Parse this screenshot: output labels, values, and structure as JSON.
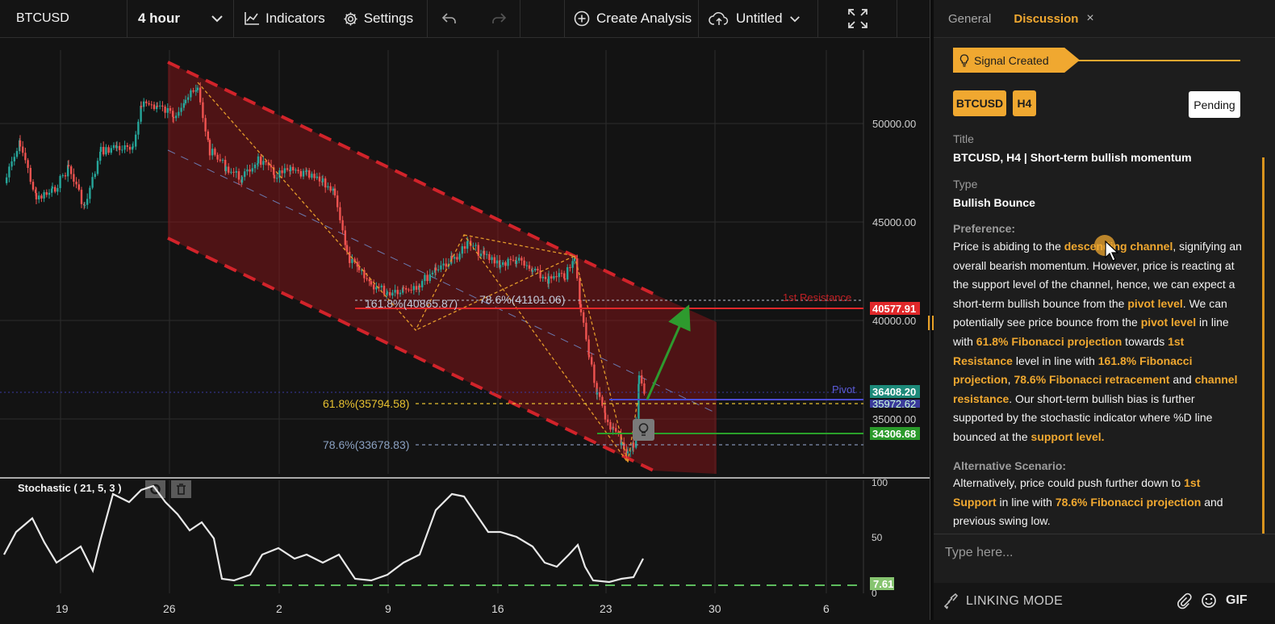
{
  "toolbar": {
    "symbol": "BTCUSD",
    "timeframe": "4 hour",
    "indicators_label": "Indicators",
    "settings_label": "Settings",
    "create_label": "Create Analysis",
    "untitled_label": "Untitled",
    "icons": {
      "timeframe": "chevron-down-icon",
      "indicators": "line-chart-icon",
      "settings": "gear-icon",
      "undo": "undo-icon",
      "redo": "redo-icon",
      "create": "plus-circle-icon",
      "untitled": "cloud-upload-icon",
      "untitled_dropdown": "chevron-down-icon",
      "fullscreen": "fullscreen-icon"
    }
  },
  "chart": {
    "price_axis": [
      "50000.00",
      "45000.00",
      "40000.00",
      "35000.00"
    ],
    "date_axis": [
      "19",
      "26",
      "2",
      "9",
      "16",
      "23",
      "30",
      "6"
    ],
    "price_tags": [
      {
        "text": "40577.91",
        "color": "#e0282a"
      },
      {
        "text": "36408.20",
        "color": "#1d8a7a"
      },
      {
        "text": "35972.62",
        "color": "#3a3a9a"
      },
      {
        "text": "34306.68",
        "color": "#2a9a2a"
      }
    ],
    "fib_labels": {
      "proj_161": "161.8%(40865.87)",
      "retr_786": "78.6%(41101.06)",
      "ret_618": "61.8%(35794.58)",
      "ret_786": "78.6%(33678.83)"
    },
    "level_labels": {
      "resistance": "1st Resistance",
      "pivot": "Pivot"
    },
    "stochastic": {
      "title": "Stochastic ( 21, 5, 3 )",
      "axis": [
        "100",
        "50",
        "0"
      ],
      "value_tag": "7.61"
    },
    "colors": {
      "channel": "#d2232a",
      "resistance": "#e0282a",
      "pivot": "#4b4bd0",
      "support": "#2aa02a",
      "fib": "#f0a830",
      "arrow": "#2e9a2e"
    }
  },
  "panel": {
    "tabs": {
      "general": "General",
      "discussion": "Discussion",
      "close": "×"
    },
    "signal": "Signal Created",
    "tags": {
      "symbol": "BTCUSD",
      "timeframe": "H4"
    },
    "status": "Pending",
    "title_label": "Title",
    "title_value": "BTCUSD, H4 | Short-term bullish momentum",
    "type_label": "Type",
    "type_value": "Bullish Bounce",
    "preference_label": "Preference:",
    "preference_segments": [
      {
        "t": "Price is abiding to the ",
        "h": false
      },
      {
        "t": "descending channel",
        "h": true
      },
      {
        "t": ", signifying an overall bearish momentum. However,  price is reacting at the support level of the channel, hence, we can expect a short-term bullish bounce from the ",
        "h": false
      },
      {
        "t": "pivot level",
        "h": true
      },
      {
        "t": ". We can potentially see price bounce from the ",
        "h": false
      },
      {
        "t": "pivot level",
        "h": true
      },
      {
        "t": " in line with ",
        "h": false
      },
      {
        "t": "61.8% Fibonacci projection",
        "h": true
      },
      {
        "t": " towards ",
        "h": false
      },
      {
        "t": "1st Resistance",
        "h": true
      },
      {
        "t": " level in line with ",
        "h": false
      },
      {
        "t": "161.8% Fibonacci projection",
        "h": true
      },
      {
        "t": ", ",
        "h": false
      },
      {
        "t": "78.6% Fibonacci retracement",
        "h": true
      },
      {
        "t": " and ",
        "h": false
      },
      {
        "t": "channel resistance",
        "h": true
      },
      {
        "t": ". Our short-term bullish bias is further supported by the stochastic indicator where %D line bounced at the ",
        "h": false
      },
      {
        "t": "support level",
        "h": true
      },
      {
        "t": ".",
        "h": true
      }
    ],
    "alt_label": "Alternative Scenario:",
    "alt_segments": [
      {
        "t": "Alternatively, price could push further down to ",
        "h": false
      },
      {
        "t": "1st Support",
        "h": true
      },
      {
        "t": " in line with ",
        "h": false
      },
      {
        "t": "78.6% Fibonacci projection",
        "h": true
      },
      {
        "t": " and previous swing low.",
        "h": false
      }
    ],
    "input_placeholder": "Type here...",
    "linking_mode": "LINKING MODE",
    "gif_label": "GIF",
    "icons": {
      "signal": "lightbulb-icon",
      "linking": "link-icon",
      "attach": "paperclip-icon",
      "emoji": "smile-icon"
    }
  }
}
